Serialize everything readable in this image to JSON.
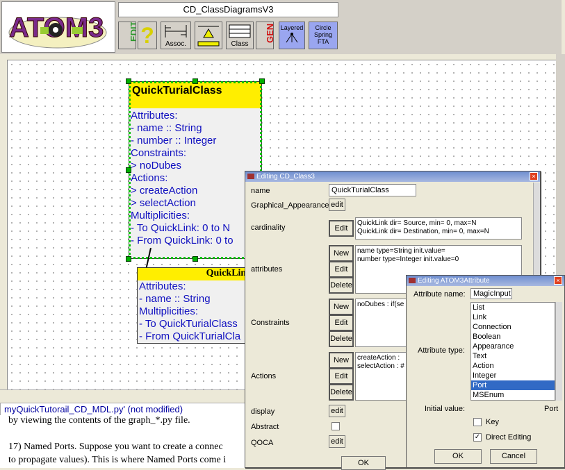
{
  "app": {
    "model_name": "CD_ClassDiagramsV3",
    "logo_text": "ATOM3"
  },
  "toolbar": {
    "edit_label": "EDIT",
    "help_label": "?",
    "assoc_label": "Assoc.",
    "class_label": "Class",
    "gen_label": "GEN",
    "layered_label": "Layered",
    "circle_label": "Circle Spring FTA"
  },
  "canvas": {
    "class_box": {
      "name": "QuickTurialClass",
      "lines": [
        "Attributes:",
        " - name :: String",
        " - number :: Integer",
        "Constraints:",
        " > noDubes",
        "Actions:",
        " > createAction",
        " > selectAction",
        "Multiplicities:",
        " - To QuickLink: 0 to N",
        " - From QuickLink: 0 to"
      ]
    },
    "link_box": {
      "name": "QuickLink",
      "lines": [
        "Attributes:",
        " - name :: String",
        "Multiplicities:",
        " - To QuickTurialClass",
        " - From QuickTurialCla"
      ]
    }
  },
  "status": {
    "file": "myQuickTutorail_CD_MDL.py' (not modified)"
  },
  "doc": {
    "line1": "by viewing the contents of the graph_*.py file.",
    "line2": "17) Named Ports. Suppose you want to create a connec",
    "line3": "to propagate values). This is where Named Ports come i"
  },
  "edit_dialog": {
    "title": "Editing CD_Class3",
    "name_label": "name",
    "name_value": "QuickTurialClass",
    "graphical_label": "Graphical_Appearance",
    "cardinality_label": "cardinality",
    "cardinality_text": [
      "QuickLink dir= Source, min= 0, max=N",
      "QuickLink dir= Destination, min= 0, max=N"
    ],
    "attributes_label": "attributes",
    "attributes_text": [
      "name type=String init.value=",
      "number type=Integer init.value=0"
    ],
    "constraints_label": "Constraints",
    "constraints_text": [
      "noDubes : if(se"
    ],
    "actions_label": "Actions",
    "actions_text": [
      "createAction : ",
      "selectAction : #"
    ],
    "display_label": "display",
    "abstract_label": "Abstract",
    "qoca_label": "QOCA",
    "edit_btn": "edit",
    "Edit_btn": "Edit",
    "new_btn": "New",
    "delete_btn": "Delete",
    "ok_btn": "OK"
  },
  "attr_dialog": {
    "title": "Editing ATOM3Attribute",
    "attr_name_label": "Attribute name:",
    "attr_name_value": "MagicInput",
    "attr_type_label": "Attribute type:",
    "types": [
      "List",
      "Link",
      "Connection",
      "Boolean",
      "Appearance",
      "Text",
      "Action",
      "Integer",
      "Port",
      "MSEnum"
    ],
    "selected_type": "Port",
    "initial_label": "Initial value:",
    "initial_value": "Port",
    "key_label": "Key",
    "direct_editing_label": "Direct Editing",
    "ok_btn": "OK",
    "cancel_btn": "Cancel"
  },
  "colors": {
    "class_header": "#ffee00",
    "class_text": "#1010c0",
    "selection": "#00b000",
    "list_selection": "#316ac5"
  }
}
